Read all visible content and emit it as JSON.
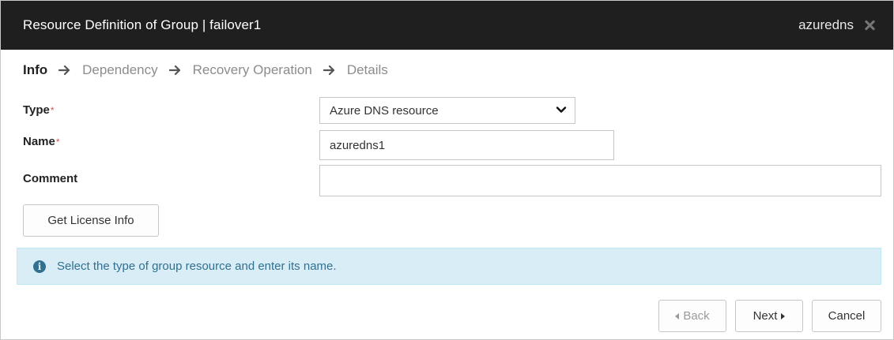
{
  "dialog": {
    "title": "Resource Definition of Group | failover1",
    "resource_name": "azuredns"
  },
  "steps": [
    {
      "label": "Info",
      "active": true
    },
    {
      "label": "Dependency",
      "active": false
    },
    {
      "label": "Recovery Operation",
      "active": false
    },
    {
      "label": "Details",
      "active": false
    }
  ],
  "form": {
    "type": {
      "label": "Type",
      "required_mark": "*",
      "value": "Azure DNS resource"
    },
    "name": {
      "label": "Name",
      "required_mark": "*",
      "value": "azuredns1"
    },
    "comment": {
      "label": "Comment",
      "value": ""
    }
  },
  "buttons": {
    "license": "Get License Info",
    "back": "Back",
    "next": "Next",
    "cancel": "Cancel"
  },
  "info": {
    "message": "Select the type of group resource and enter its name."
  },
  "colors": {
    "titlebar_bg": "#1f1f1f",
    "required": "#d9534f",
    "alert_bg": "#d9edf7",
    "alert_text": "#31708f"
  }
}
